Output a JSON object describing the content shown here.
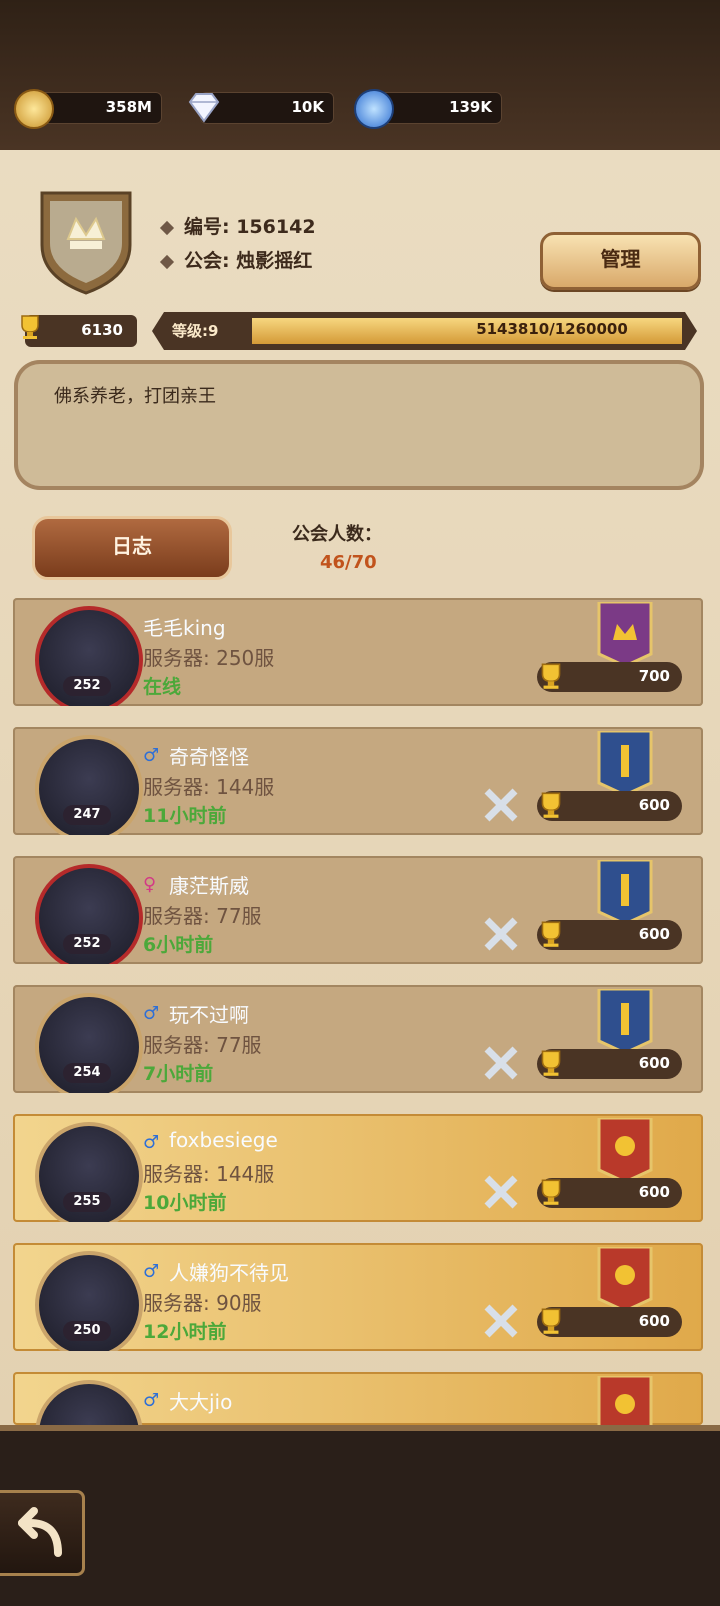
{
  "resources": [
    {
      "icon": "gold-coin-icon",
      "value": "358M"
    },
    {
      "icon": "diamond-icon",
      "value": "10K"
    },
    {
      "icon": "blue-gem-icon",
      "value": "139K"
    }
  ],
  "guild": {
    "id_label": "编号: 156142",
    "name_label": "公会: 烛影摇红",
    "manage_label": "管理",
    "trophy": "6130",
    "level_label": "等级:9",
    "progress_text": "5143810/1260000",
    "notice": "佛系养老，打团亲王",
    "log_label": "日志",
    "member_count_label": "公会人数：",
    "member_count": "46/70"
  },
  "members": [
    {
      "name": "毛毛king",
      "server": "服务器: 250服",
      "status": "在线",
      "level": "252",
      "trophy": "700",
      "gender": ""
    },
    {
      "name": "奇奇怪怪",
      "server": "服务器: 144服",
      "status": "11小时前",
      "level": "247",
      "trophy": "600",
      "gender": "♂"
    },
    {
      "name": "康茫斯威",
      "server": "服务器: 77服",
      "status": "6小时前",
      "level": "252",
      "trophy": "600",
      "gender": "♀"
    },
    {
      "name": "玩不过啊",
      "server": "服务器: 77服",
      "status": "7小时前",
      "level": "254",
      "trophy": "600",
      "gender": "♂"
    },
    {
      "name": "foxbesiege",
      "server": "服务器: 144服",
      "status": "10小时前",
      "level": "255",
      "trophy": "600",
      "gender": "♂"
    },
    {
      "name": "人嫌狗不待见",
      "server": "服务器: 90服",
      "status": "12小时前",
      "level": "250",
      "trophy": "600",
      "gender": "♂"
    },
    {
      "name": "大大jio",
      "server": "",
      "status": "",
      "level": "",
      "trophy": "",
      "gender": "♂"
    }
  ]
}
